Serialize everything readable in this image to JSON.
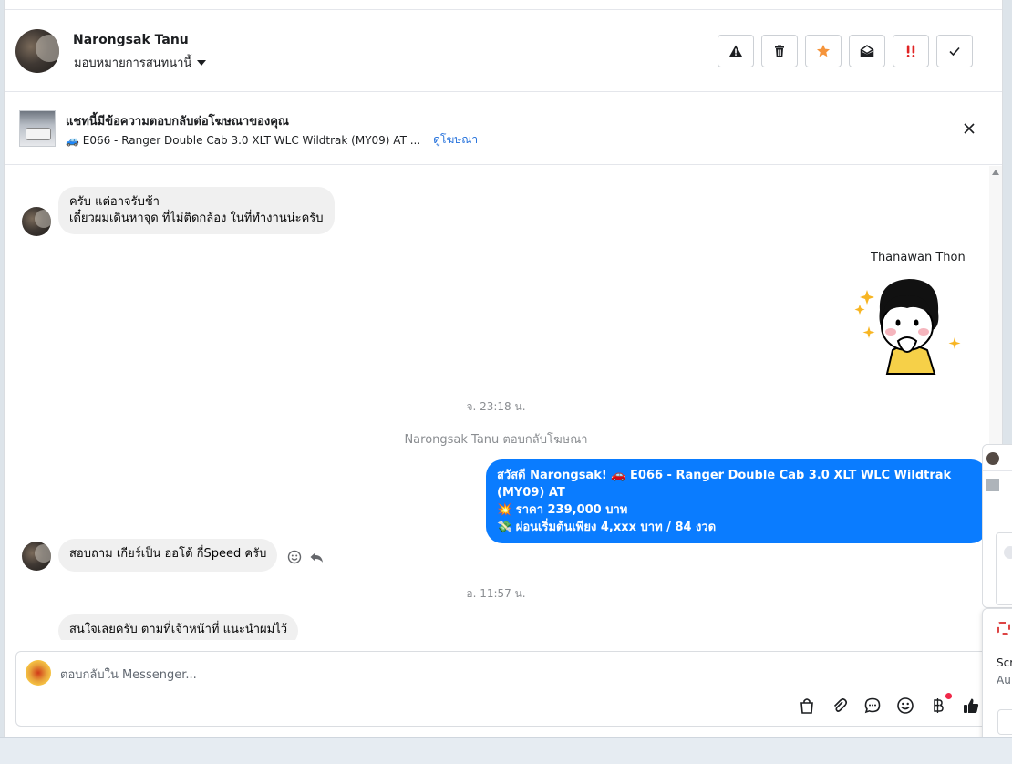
{
  "header": {
    "contact_name": "Narongsak Tanu",
    "assign_label": "มอบหมายการสนทนานี้",
    "actions": [
      {
        "name": "report-button",
        "icon": "warning-icon"
      },
      {
        "name": "delete-button",
        "icon": "trash-icon"
      },
      {
        "name": "star-button",
        "icon": "star-icon",
        "color": "#f5943b"
      },
      {
        "name": "mark-unread-button",
        "icon": "envelope-open-icon"
      },
      {
        "name": "important-button",
        "icon": "double-exclamation-icon",
        "color": "#e02424"
      },
      {
        "name": "done-button",
        "icon": "check-icon"
      }
    ]
  },
  "ad_banner": {
    "title": "แชทนี้มีข้อความตอบกลับต่อโฆษณาของคุณ",
    "ad_text": "🚙 E066 - Ranger Double Cab 3.0 XLT WLC Wildtrak (MY09) AT ...",
    "view_ad_link": "ดูโฆษณา"
  },
  "messages": {
    "m1": {
      "line1": "ครับ แต่อาจรับช้า",
      "line2": "เดี๋ยวผมเดินหาจุด ที่ไม่ติดกล้อง ในที่ทำงานน่ะครับ"
    },
    "sticker_sender": "Thanawan Thon",
    "time1": "จ. 23:18 น.",
    "system_reply": "Narongsak Tanu ตอบกลับโฆษณา",
    "m2": {
      "line1": "สวัสดี Narongsak! 🚗 E066 - Ranger Double Cab 3.0 XLT WLC Wildtrak (MY09) AT",
      "line2": "💥 ราคา 239,000 บาท",
      "line3": "💸 ผ่อนเริ่มต้นเพียง 4,xxx บาท / 84 งวด"
    },
    "m3": "สอบถาม เกียร์เป็น ออโต้ กี่Speed ครับ",
    "time2": "อ. 11:57 น.",
    "m4": "สนใจเลยครับ ตามที่เจ้าหน้าที่ แนะนำผมไว้"
  },
  "composer": {
    "placeholder": "ตอบกลับใน Messenger...",
    "tools": [
      "shopping-bag-icon",
      "paperclip-icon",
      "chat-bubble-icon",
      "emoji-icon",
      "baht-icon",
      "thumbs-up-icon"
    ]
  },
  "side_panel": {
    "text1": "Scr",
    "text2": "Au"
  },
  "colors": {
    "outgoing_bubble": "#0a7cff",
    "incoming_bubble": "#f0f0f0",
    "link": "#216fdb"
  }
}
